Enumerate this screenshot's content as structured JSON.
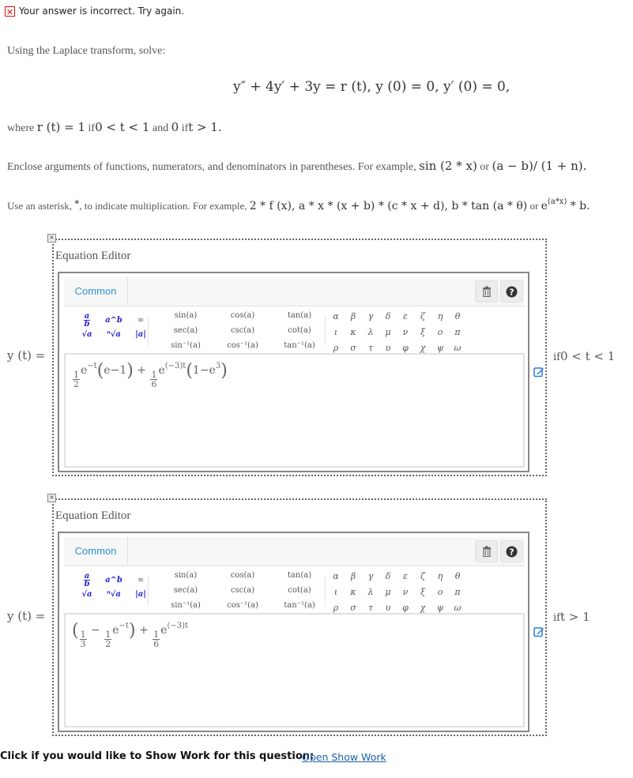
{
  "feedback": {
    "icon": "x-icon",
    "text": "Your answer is incorrect.  Try again."
  },
  "problem": {
    "intro": "Using the Laplace transform, solve:",
    "equation": "y″ + 4y′ + 3y = r (t),  y (0) = 0,  y′ (0) = 0,",
    "where_prefix": "where",
    "where_math_r": "r (t) = 1",
    "where_if1": "if",
    "where_range1": "0 < t < 1",
    "where_and": "and",
    "where_zero": "0",
    "where_if2": "if",
    "where_range2": "t > 1.",
    "enclose_text": "Enclose arguments of functions, numerators, and denominators in parentheses. For example,",
    "enclose_ex1": "sin (2 * x)",
    "enclose_or": "or",
    "enclose_ex2": "(a − b)/ (1 + n).",
    "asterisk_text1": "Use an asterisk,",
    "asterisk_symbol": "*",
    "asterisk_text2": ", to indicate multiplication. For example,",
    "asterisk_ex1": "2 * f (x), a * x * (x + b) * (c * x + d), b * tan (a * θ)",
    "asterisk_or": "or",
    "asterisk_ex2_base": "e",
    "asterisk_ex2_exp": "(a*x)",
    "asterisk_ex2_tail": "* b."
  },
  "editors": [
    {
      "title": "Equation Editor",
      "close_icon": "close-icon",
      "tab": "Common",
      "lhs": "y (t) =",
      "condition_if": "if",
      "condition": "0 < t < 1",
      "answer_text": "1/2 e^(-t) (e-1) + 1/6 e^((-3)t) (1-e^3)",
      "answer_parts": {
        "c1_num": "1",
        "c1_den": "2",
        "e1": "e",
        "e1_exp": "−t",
        "p1": "e−1",
        "c2_num": "1",
        "c2_den": "6",
        "e2": "e",
        "e2_exp": "(−3)t",
        "p2": "1−e",
        "p2_exp": "3"
      }
    },
    {
      "title": "Equation Editor",
      "close_icon": "close-icon",
      "tab": "Common",
      "lhs": "y (t) =",
      "condition_if": "if",
      "condition": "t > 1",
      "answer_text": "(1/3 - 1/2 e^(-t)) + 1/6 e^((-3)t)",
      "answer_parts": {
        "a_num": "1",
        "a_den": "3",
        "minus": "−",
        "b_num": "1",
        "b_den": "2",
        "e1": "e",
        "e1_exp": "−t",
        "c_num": "1",
        "c_den": "6",
        "e2": "e",
        "e2_exp": "(−3)t"
      }
    }
  ],
  "palette": {
    "basic": [
      "a/b",
      "a^b",
      "∞",
      "√a",
      "ⁿ√a",
      "|a|"
    ],
    "trig": [
      "sin(a)",
      "cos(a)",
      "tan(a)",
      "sec(a)",
      "csc(a)",
      "cot(a)",
      "sin⁻¹(a)",
      "cos⁻¹(a)",
      "tan⁻¹(a)"
    ],
    "greek": [
      "α",
      "β",
      "γ",
      "δ",
      "ε",
      "ζ",
      "η",
      "θ",
      "ι",
      "κ",
      "λ",
      "μ",
      "ν",
      "ξ",
      "ο",
      "π",
      "ρ",
      "σ",
      "τ",
      "υ",
      "φ",
      "χ",
      "ψ",
      "ω"
    ],
    "tools": [
      "trash-icon",
      "help-icon"
    ]
  },
  "footer": {
    "prompt": "Click if you would like to Show Work for this question:",
    "link": "Open Show Work"
  },
  "colors": {
    "error": "#dd1111",
    "tab_link": "#2b93d6",
    "palette_arg": "#2222cc",
    "link": "#1a5ea8",
    "edit_icon": "#2b7bd6"
  }
}
